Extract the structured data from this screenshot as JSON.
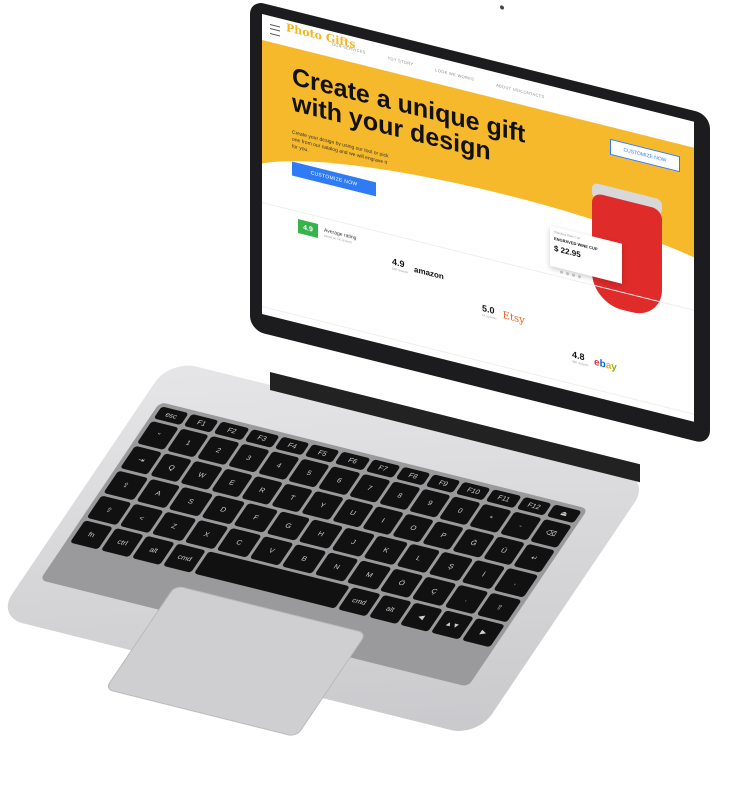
{
  "site": {
    "logo": "Photo Gifts",
    "nav": [
      "OUR SERVICES",
      "TOY STORY",
      "LOOK WE WORKS",
      "ABOUT US/CONTACTS"
    ],
    "customize_top_label": "CUSTOMIZE NOW",
    "headline": "Create a unique gift with your design",
    "subtext": "Create your design by using our tool or pick one from our catalog and we will engrave it for you.",
    "customize_label": "CUSTOMIZE NOW"
  },
  "product_card": {
    "small": "Stainless Steel Cup",
    "name": "ENGRAVED WINE CUP",
    "price": "$ 22.95"
  },
  "ratings": {
    "average_value": "4.9",
    "average_label": "Average rating",
    "average_sub": "based on 1K reviews",
    "items": [
      {
        "value": "4.9",
        "caption": "500 reviews",
        "brand": "amazon"
      },
      {
        "value": "5.0",
        "caption": "1K reviews",
        "brand": "Etsy"
      },
      {
        "value": "4.8",
        "caption": "300 reviews",
        "brand": "ebay"
      }
    ]
  },
  "keyboard": {
    "rows": [
      [
        "esc",
        "F1",
        "F2",
        "F3",
        "F4",
        "F5",
        "F6",
        "F7",
        "F8",
        "F9",
        "F10",
        "F11",
        "F12",
        "⏏"
      ],
      [
        "\"",
        "1",
        "2",
        "3",
        "4",
        "5",
        "6",
        "7",
        "8",
        "9",
        "0",
        "*",
        "-",
        "⌫"
      ],
      [
        "⇥",
        "Q",
        "W",
        "E",
        "R",
        "T",
        "Y",
        "U",
        "I",
        "O",
        "P",
        "Ğ",
        "Ü",
        "↵"
      ],
      [
        "⇪",
        "A",
        "S",
        "D",
        "F",
        "G",
        "H",
        "J",
        "K",
        "L",
        "Ş",
        "İ",
        ","
      ],
      [
        "⇧",
        "<",
        "Z",
        "X",
        "C",
        "V",
        "B",
        "N",
        "M",
        "Ö",
        "Ç",
        ".",
        "⇧"
      ],
      [
        "fn",
        "ctrl",
        "alt",
        "cmd",
        "",
        "cmd",
        "alt",
        "◀",
        "▲▼",
        "▶"
      ]
    ]
  },
  "colors": {
    "hero_yellow": "#f6b92b",
    "cta_blue": "#2f7bf5",
    "cup_red": "#e02b2b",
    "rating_green": "#36b34a"
  }
}
